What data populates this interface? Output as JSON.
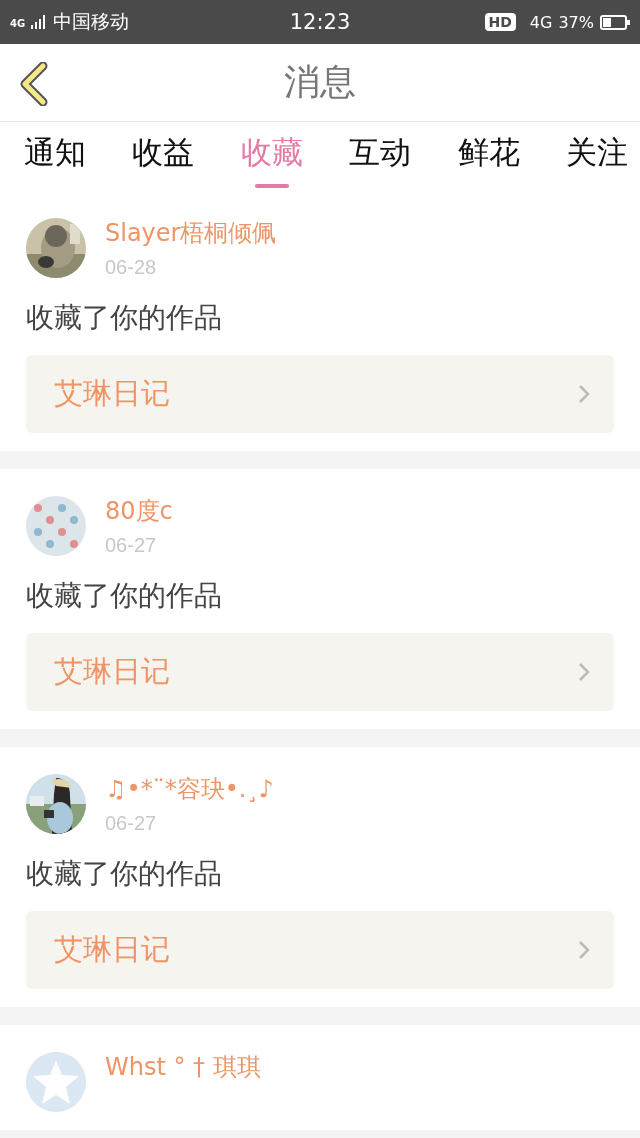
{
  "status_bar": {
    "network_small": "4G",
    "carrier": "中国移动",
    "time": "12:23",
    "hd_badge": "HD",
    "network": "4G",
    "battery": "37%"
  },
  "header": {
    "title": "消息"
  },
  "tabs": [
    {
      "label": "通知",
      "selected": false
    },
    {
      "label": "收益",
      "selected": false
    },
    {
      "label": "收藏",
      "selected": true
    },
    {
      "label": "互动",
      "selected": false
    },
    {
      "label": "鲜花",
      "selected": false
    },
    {
      "label": "关注",
      "selected": false
    }
  ],
  "messages": [
    {
      "name": "Slayer梧桐倾佩",
      "date": "06-28",
      "text": "收藏了你的作品",
      "work": "艾琳日记"
    },
    {
      "name": "80度c",
      "date": "06-27",
      "text": "收藏了你的作品",
      "work": "艾琳日记"
    },
    {
      "name": "♫•*¨*容玦•.¸♪",
      "date": "06-27",
      "text": "收藏了你的作品",
      "work": "艾琳日记"
    },
    {
      "avatar": {
        "kind": "default"
      },
      "name": "Whst ° † 琪琪"
    }
  ]
}
